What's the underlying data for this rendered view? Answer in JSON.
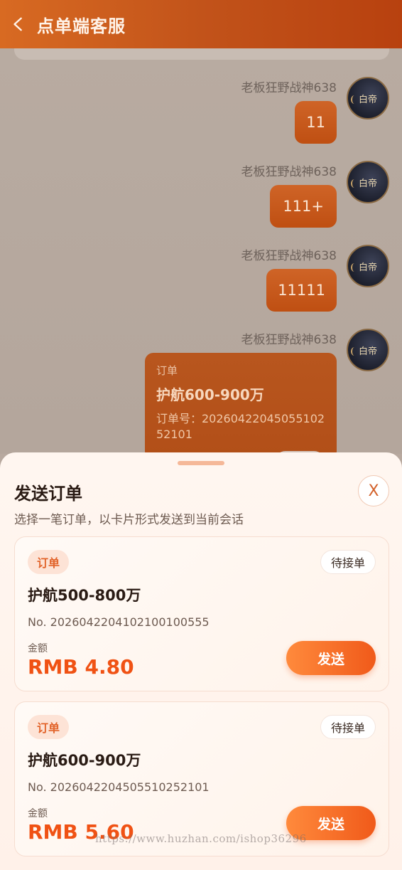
{
  "header": {
    "title": "点单端客服",
    "back_icon": "chevron-left-icon"
  },
  "chat": {
    "messages": [
      {
        "sender": "老板狂野战神638",
        "text": "11",
        "avatar_text": "白帝"
      },
      {
        "sender": "老板狂野战神638",
        "text": "111+",
        "avatar_text": "白帝"
      },
      {
        "sender": "老板狂野战神638",
        "text": "11111",
        "avatar_text": "白帝"
      },
      {
        "sender": "老板狂野战神638",
        "avatar_text": "白帝",
        "order": {
          "label": "订单",
          "title": "护航600-900万",
          "number": "订单号：2026042204505510252101"
        }
      }
    ]
  },
  "sheet": {
    "title": "发送订单",
    "subtitle": "选择一笔订单，以卡片形式发送到当前会话",
    "close_label": "X",
    "orders": [
      {
        "tag": "订单",
        "status": "待接单",
        "title": "护航500-800万",
        "number": "No. 2026042204102100100555",
        "amount_label": "金额",
        "amount": "RMB 4.80",
        "send_label": "发送"
      },
      {
        "tag": "订单",
        "status": "待接单",
        "title": "护航600-900万",
        "number": "No. 2026042204505510252101",
        "amount_label": "金额",
        "amount": "RMB 5.60",
        "send_label": "发送"
      }
    ]
  },
  "watermark": "https://www.huzhan.com/ishop36296",
  "colors": {
    "accent": "#f05a1a",
    "header": "#c2531a",
    "bubble": "#c65a1d"
  }
}
